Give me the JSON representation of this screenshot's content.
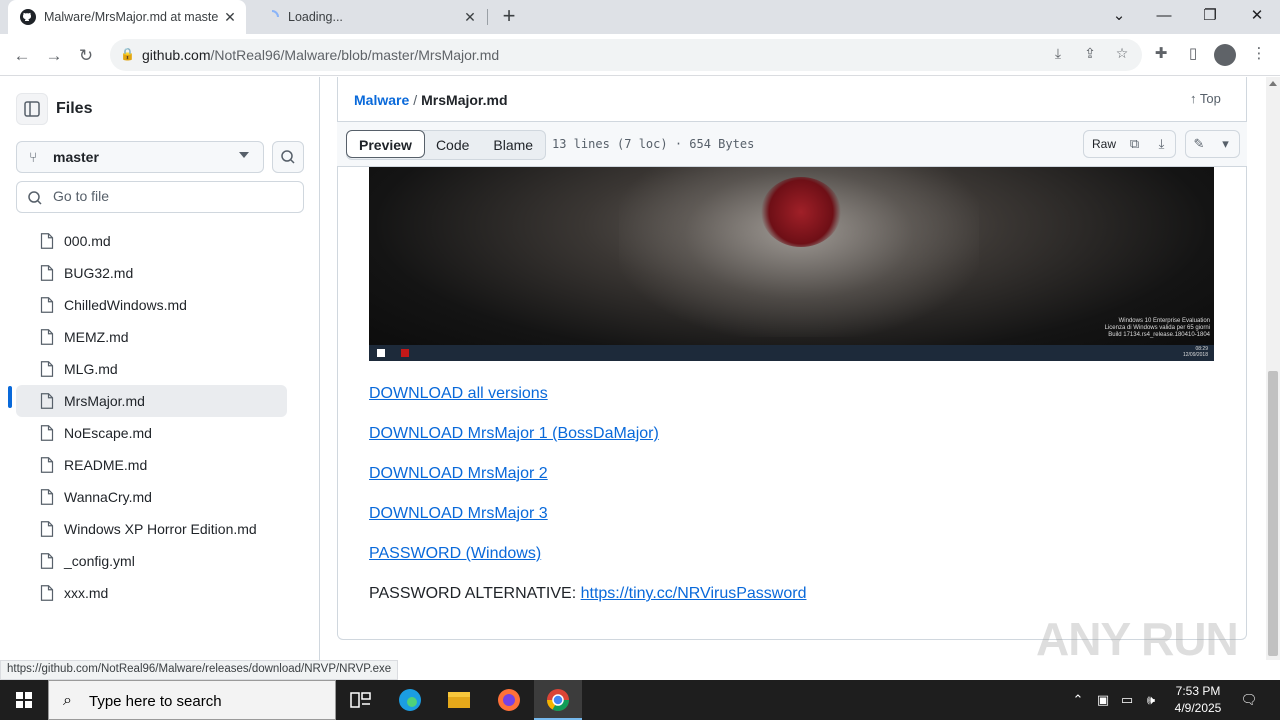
{
  "browser": {
    "tabs": [
      {
        "title": "Malware/MrsMajor.md at maste"
      },
      {
        "title": "Loading..."
      }
    ],
    "url_domain": "github.com",
    "url_path": "/NotReal96/Malware/blob/master/MrsMajor.md",
    "status_url": "https://github.com/NotReal96/Malware/releases/download/NRVP/NRVP.exe"
  },
  "sidebar": {
    "title": "Files",
    "branch": "master",
    "goto_placeholder": "Go to file",
    "files": [
      "000.md",
      "BUG32.md",
      "ChilledWindows.md",
      "MEMZ.md",
      "MLG.md",
      "MrsMajor.md",
      "NoEscape.md",
      "README.md",
      "WannaCry.md",
      "Windows XP Horror Edition.md",
      "_config.yml",
      "xxx.md"
    ],
    "active_index": 5
  },
  "file": {
    "repo": "Malware",
    "separator": "/",
    "name": "MrsMajor.md",
    "top_label": "Top",
    "tabs": [
      "Preview",
      "Code",
      "Blame"
    ],
    "meta": "13 lines (7 loc) · 654 Bytes",
    "raw_label": "Raw"
  },
  "embedded_screenshot": {
    "win_text_1": "Windows 10 Enterprise Evaluation",
    "win_text_2": "Licenza di Windows valida per 65 giorni",
    "win_text_3": "Build 17134.rs4_release.180410-1804",
    "time": "08:29",
    "date": "12/09/2018"
  },
  "links": [
    "DOWNLOAD all versions",
    "DOWNLOAD MrsMajor 1 (BossDaMajor)",
    "DOWNLOAD MrsMajor 2",
    "DOWNLOAD MrsMajor 3",
    "PASSWORD (Windows)"
  ],
  "password_alt": {
    "label": "PASSWORD ALTERNATIVE:",
    "link": "https://tiny.cc/NRVirusPassword"
  },
  "watermark": "ANY RUN",
  "taskbar": {
    "search_placeholder": "Type here to search",
    "time": "7:53 PM",
    "date": "4/9/2025"
  }
}
